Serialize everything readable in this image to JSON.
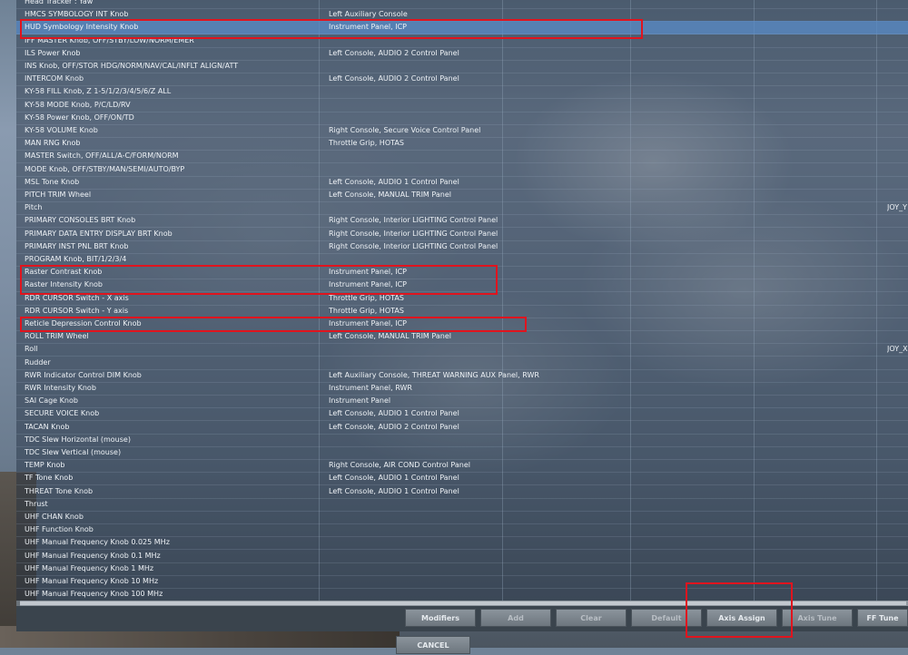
{
  "rows": [
    {
      "name": "Head Tracker : Yaw",
      "category": "",
      "joy": ""
    },
    {
      "name": "HMCS SYMBOLOGY INT Knob",
      "category": "Left Auxiliary Console",
      "joy": ""
    },
    {
      "name": "HUD Symbology Intensity Knob",
      "category": "Instrument Panel, ICP",
      "joy": ""
    },
    {
      "name": "IFF MASTER Knob, OFF/STBY/LOW/NORM/EMER",
      "category": "",
      "joy": ""
    },
    {
      "name": "ILS Power Knob",
      "category": "Left Console, AUDIO 2 Control Panel",
      "joy": ""
    },
    {
      "name": "INS Knob, OFF/STOR HDG/NORM/NAV/CAL/INFLT ALIGN/ATT",
      "category": "",
      "joy": ""
    },
    {
      "name": "INTERCOM Knob",
      "category": "Left Console, AUDIO 2 Control Panel",
      "joy": ""
    },
    {
      "name": "KY-58 FILL Knob, Z 1-5/1/2/3/4/5/6/Z ALL",
      "category": "",
      "joy": ""
    },
    {
      "name": "KY-58 MODE Knob, P/C/LD/RV",
      "category": "",
      "joy": ""
    },
    {
      "name": "KY-58 Power Knob, OFF/ON/TD",
      "category": "",
      "joy": ""
    },
    {
      "name": "KY-58 VOLUME Knob",
      "category": "Right Console, Secure Voice Control Panel",
      "joy": ""
    },
    {
      "name": "MAN RNG Knob",
      "category": "Throttle Grip, HOTAS",
      "joy": ""
    },
    {
      "name": "MASTER Switch, OFF/ALL/A-C/FORM/NORM",
      "category": "",
      "joy": ""
    },
    {
      "name": "MODE Knob, OFF/STBY/MAN/SEMI/AUTO/BYP",
      "category": "",
      "joy": ""
    },
    {
      "name": "MSL Tone Knob",
      "category": "Left Console, AUDIO 1 Control Panel",
      "joy": ""
    },
    {
      "name": "PITCH TRIM Wheel",
      "category": "Left Console, MANUAL TRIM Panel",
      "joy": ""
    },
    {
      "name": "Pitch",
      "category": "",
      "joy": "JOY_Y"
    },
    {
      "name": "PRIMARY CONSOLES BRT Knob",
      "category": "Right Console, Interior LIGHTING Control Panel",
      "joy": ""
    },
    {
      "name": "PRIMARY DATA ENTRY DISPLAY BRT Knob",
      "category": "Right Console, Interior LIGHTING Control Panel",
      "joy": ""
    },
    {
      "name": "PRIMARY INST PNL BRT Knob",
      "category": "Right Console, Interior LIGHTING Control Panel",
      "joy": ""
    },
    {
      "name": "PROGRAM Knob, BIT/1/2/3/4",
      "category": "",
      "joy": ""
    },
    {
      "name": "Raster Contrast Knob",
      "category": "Instrument Panel, ICP",
      "joy": ""
    },
    {
      "name": "Raster Intensity Knob",
      "category": "Instrument Panel, ICP",
      "joy": ""
    },
    {
      "name": "RDR CURSOR Switch - X axis",
      "category": "Throttle Grip, HOTAS",
      "joy": ""
    },
    {
      "name": "RDR CURSOR Switch - Y axis",
      "category": "Throttle Grip, HOTAS",
      "joy": ""
    },
    {
      "name": "Reticle Depression Control Knob",
      "category": "Instrument Panel, ICP",
      "joy": ""
    },
    {
      "name": "ROLL TRIM Wheel",
      "category": "Left Console, MANUAL TRIM Panel",
      "joy": ""
    },
    {
      "name": "Roll",
      "category": "",
      "joy": "JOY_X"
    },
    {
      "name": "Rudder",
      "category": "",
      "joy": ""
    },
    {
      "name": "RWR Indicator Control DIM Knob",
      "category": "Left Auxiliary Console, THREAT WARNING AUX Panel, RWR",
      "joy": ""
    },
    {
      "name": "RWR Intensity Knob",
      "category": "Instrument Panel, RWR",
      "joy": ""
    },
    {
      "name": "SAI Cage Knob",
      "category": "Instrument Panel",
      "joy": ""
    },
    {
      "name": "SECURE VOICE Knob",
      "category": "Left Console, AUDIO 1 Control Panel",
      "joy": ""
    },
    {
      "name": "TACAN Knob",
      "category": "Left Console, AUDIO 2 Control Panel",
      "joy": ""
    },
    {
      "name": "TDC Slew Horizontal (mouse)",
      "category": "",
      "joy": ""
    },
    {
      "name": "TDC Slew Vertical (mouse)",
      "category": "",
      "joy": ""
    },
    {
      "name": "TEMP Knob",
      "category": "Right Console, AIR COND Control Panel",
      "joy": ""
    },
    {
      "name": "TF Tone Knob",
      "category": "Left Console, AUDIO 1 Control Panel",
      "joy": ""
    },
    {
      "name": "THREAT Tone Knob",
      "category": "Left Console, AUDIO 1 Control Panel",
      "joy": ""
    },
    {
      "name": "Thrust",
      "category": "",
      "joy": ""
    },
    {
      "name": "UHF CHAN Knob",
      "category": "",
      "joy": ""
    },
    {
      "name": "UHF Function Knob",
      "category": "",
      "joy": ""
    },
    {
      "name": "UHF Manual Frequency Knob 0.025 MHz",
      "category": "",
      "joy": ""
    },
    {
      "name": "UHF Manual Frequency Knob 0.1 MHz",
      "category": "",
      "joy": ""
    },
    {
      "name": "UHF Manual Frequency Knob 1 MHz",
      "category": "",
      "joy": ""
    },
    {
      "name": "UHF Manual Frequency Knob 10 MHz",
      "category": "",
      "joy": ""
    },
    {
      "name": "UHF Manual Frequency Knob 100 MHz",
      "category": "",
      "joy": ""
    }
  ],
  "selected_row": 2,
  "buttons": {
    "modifiers": "Modifiers",
    "add": "Add",
    "clear": "Clear",
    "default": "Default",
    "axis_assign": "Axis Assign",
    "axis_tune": "Axis Tune",
    "ff_tune": "FF Tune",
    "cancel": "CANCEL"
  },
  "colors": {
    "highlight": "#e0141e",
    "selected_row": "#5a8cc8"
  }
}
